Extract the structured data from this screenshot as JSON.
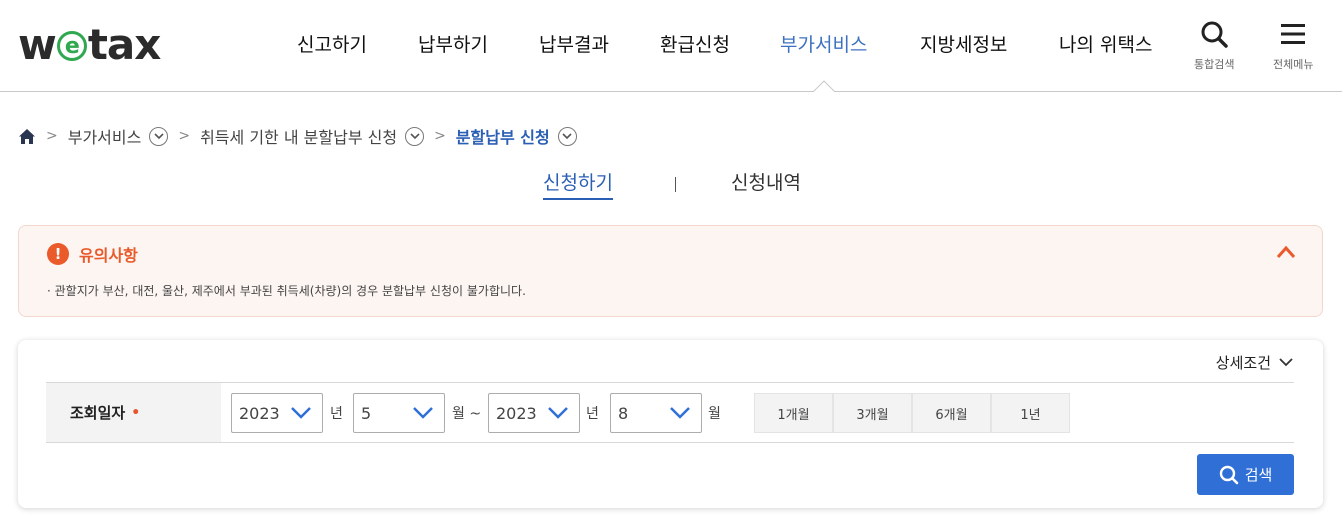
{
  "logo": {
    "text_w": "w",
    "text_e": "e",
    "text_tax": "tax"
  },
  "gnb": {
    "items": [
      {
        "label": "신고하기",
        "active": false
      },
      {
        "label": "납부하기",
        "active": false
      },
      {
        "label": "납부결과",
        "active": false
      },
      {
        "label": "환급신청",
        "active": false
      },
      {
        "label": "부가서비스",
        "active": true
      },
      {
        "label": "지방세정보",
        "active": false
      },
      {
        "label": "나의 위택스",
        "active": false
      }
    ],
    "search_label": "통합검색",
    "menu_label": "전체메뉴"
  },
  "breadcrumb": {
    "items": [
      "부가서비스",
      "취득세 기한 내 분할납부 신청",
      "분할납부 신청"
    ]
  },
  "tabs": {
    "active": "신청하기",
    "inactive": "신청내역"
  },
  "notice": {
    "title": "유의사항",
    "text": "· 관할지가 부산, 대전, 울산, 제주에서 부과된 취득세(차량)의 경우 분할납부 신청이 불가합니다."
  },
  "search": {
    "detail_label": "상세조건",
    "row_label": "조회일자",
    "required_mark": "•",
    "start_year": "2023",
    "year_unit": "년",
    "start_month": "5",
    "month_unit_tilde": "월 ~",
    "end_year": "2023",
    "end_year_unit": "년",
    "end_month": "8",
    "end_month_unit": "월",
    "periods": [
      "1개월",
      "3개월",
      "6개월",
      "1년"
    ],
    "button_label": "검색"
  },
  "colors": {
    "accent": "#2b5fb4",
    "active_nav": "#3d72c2",
    "warn": "#ea5a2a",
    "button": "#2f6fd6"
  }
}
